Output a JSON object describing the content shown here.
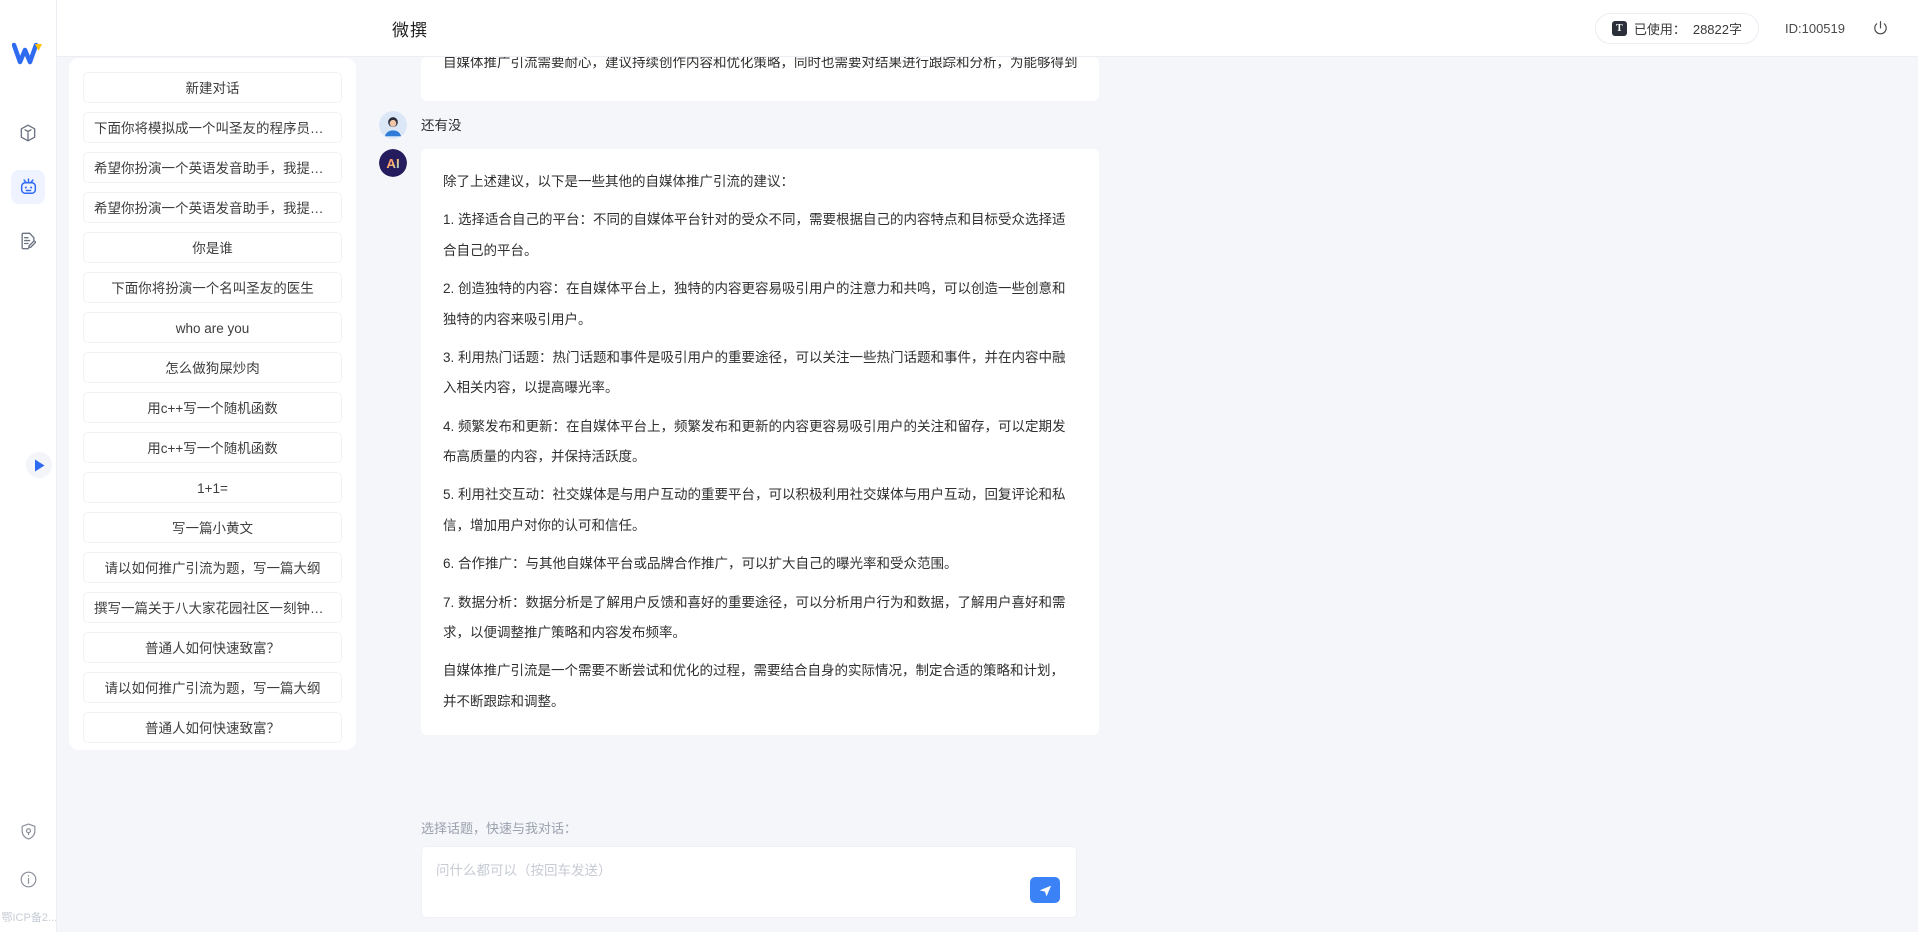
{
  "header": {
    "app_title": "微撰",
    "usage_label": "已使用：",
    "usage_value": "28822字",
    "usage_icon": "text-badge-icon",
    "user_id": "ID:100519",
    "power_icon": "power-icon"
  },
  "rail": {
    "logo": "w-logo",
    "icons": [
      {
        "name": "cube-icon",
        "active": false
      },
      {
        "name": "robot-icon",
        "active": true
      },
      {
        "name": "document-edit-icon",
        "active": false
      }
    ],
    "expand_icon": "play-triangle-icon",
    "bottom_icons": [
      {
        "name": "shield-lock-icon"
      },
      {
        "name": "info-icon"
      }
    ],
    "icp_text": "鄂ICP备2..."
  },
  "sidebar": {
    "new_chat_label": "新建对话",
    "items": [
      {
        "label": "下面你将模拟成一个叫圣友的程序员，我说...",
        "align": "left"
      },
      {
        "label": "希望你扮演一个英语发音助手，我提供给你...",
        "align": "left"
      },
      {
        "label": "希望你扮演一个英语发音助手，我提供给你...",
        "align": "left"
      },
      {
        "label": "你是谁",
        "align": "center"
      },
      {
        "label": "下面你将扮演一个名叫圣友的医生",
        "align": "center"
      },
      {
        "label": "who are you",
        "align": "center"
      },
      {
        "label": "怎么做狗屎炒肉",
        "align": "center"
      },
      {
        "label": "用c++写一个随机函数",
        "align": "center"
      },
      {
        "label": "用c++写一个随机函数",
        "align": "center"
      },
      {
        "label": "1+1=",
        "align": "center"
      },
      {
        "label": "写一篇小黄文",
        "align": "center"
      },
      {
        "label": "请以如何推广引流为题，写一篇大纲",
        "align": "center"
      },
      {
        "label": "撰写一篇关于八大家花园社区一刻钟便民生...",
        "align": "left"
      },
      {
        "label": "普通人如何快速致富？",
        "align": "center"
      },
      {
        "label": "请以如何推广引流为题，写一篇大纲",
        "align": "center"
      },
      {
        "label": "普通人如何快速致富？",
        "align": "center"
      }
    ]
  },
  "chat": {
    "clipped_top_line": "自媒体推广引流需要耐心，建议持续创作内容和优化策略，同时也需要对结果进行跟踪和分析，为能够得到更好的效果。",
    "messages": [
      {
        "role": "user",
        "avatar": "user-avatar",
        "text": "还有没"
      },
      {
        "role": "assistant",
        "avatar": "ai-avatar",
        "paragraphs": [
          "除了上述建议，以下是一些其他的自媒体推广引流的建议：",
          "1. 选择适合自己的平台：不同的自媒体平台针对的受众不同，需要根据自己的内容特点和目标受众选择适合自己的平台。",
          "2. 创造独特的内容：在自媒体平台上，独特的内容更容易吸引用户的注意力和共鸣，可以创造一些创意和独特的内容来吸引用户。",
          "3. 利用热门话题：热门话题和事件是吸引用户的重要途径，可以关注一些热门话题和事件，并在内容中融入相关内容，以提高曝光率。",
          "4. 频繁发布和更新：在自媒体平台上，频繁发布和更新的内容更容易吸引用户的关注和留存，可以定期发布高质量的内容，并保持活跃度。",
          "5. 利用社交互动：社交媒体是与用户互动的重要平台，可以积极利用社交媒体与用户互动，回复评论和私信，增加用户对你的认可和信任。",
          "6. 合作推广：与其他自媒体平台或品牌合作推广，可以扩大自己的曝光率和受众范围。",
          "7. 数据分析：数据分析是了解用户反馈和喜好的重要途径，可以分析用户行为和数据，了解用户喜好和需求，以便调整推广策略和内容发布频率。",
          "自媒体推广引流是一个需要不断尝试和优化的过程，需要结合自身的实际情况，制定合适的策略和计划，并不断跟踪和调整。"
        ]
      }
    ]
  },
  "composer": {
    "label": "选择话题，快速与我对话：",
    "placeholder": "问什么都可以（按回车发送）",
    "value": "",
    "send_icon": "send-plane-icon"
  },
  "colors": {
    "accent": "#3b82f6",
    "page_bg": "#f5f6fa",
    "panel_bg": "#ffffff",
    "text": "#2f2f2f",
    "muted": "#9aa0ad"
  }
}
